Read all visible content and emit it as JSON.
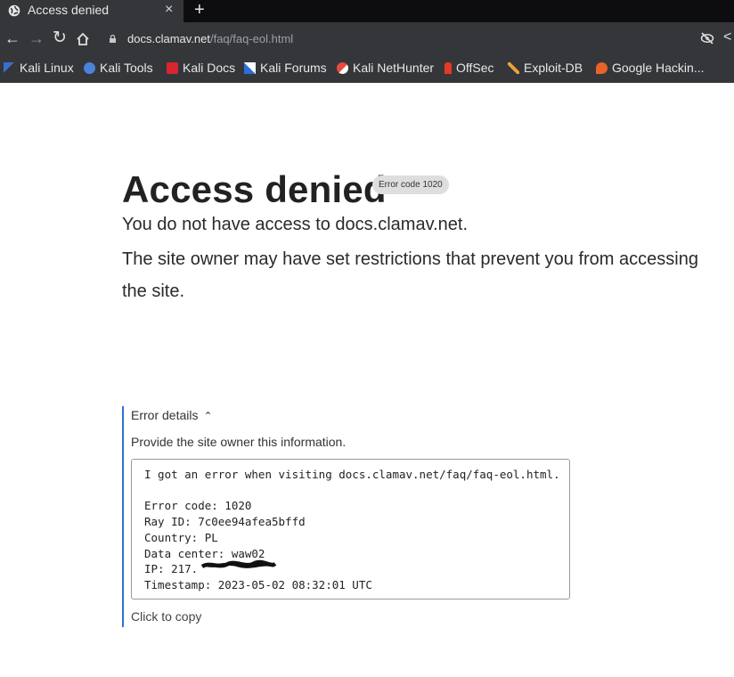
{
  "tab": {
    "title": "Access denied",
    "close": "×",
    "new_tab": "+"
  },
  "toolbar": {
    "url_host": "docs.clamav.net",
    "url_path": "/faq/faq-eol.html"
  },
  "bookmarks": [
    {
      "label": "Kali Linux",
      "icon": "kali-dragon-icon",
      "color": "#3a6fd1"
    },
    {
      "label": "Kali Tools",
      "icon": "kali-tools-icon",
      "color": "#4b83d9"
    },
    {
      "label": "Kali Docs",
      "icon": "kali-docs-icon",
      "color": "#d8262e"
    },
    {
      "label": "Kali Forums",
      "icon": "kali-forums-icon",
      "color": "#2d6fd6"
    },
    {
      "label": "Kali NetHunter",
      "icon": "nethunter-icon",
      "color": "#e84b3c"
    },
    {
      "label": "OffSec",
      "icon": "offsec-icon",
      "color": "#e23b2a"
    },
    {
      "label": "Exploit-DB",
      "icon": "exploit-db-icon",
      "color": "#e8a23a"
    },
    {
      "label": "Google Hackin...",
      "icon": "ghdb-icon",
      "color": "#e8632a"
    }
  ],
  "main": {
    "heading": "Access denied",
    "error_badge": "Error code 1020",
    "line1": "You do not have access to docs.clamav.net.",
    "line2": "The site owner may have set restrictions that prevent you from accessing",
    "line3": "the site."
  },
  "details": {
    "summary": "Error details",
    "hint": "Provide the site owner this information.",
    "lines": [
      "I got an error when visiting docs.clamav.net/faq/faq-eol.html.",
      "",
      "Error code: 1020",
      "Ray ID: 7c0ee94afea5bffd",
      "Country: PL",
      "Data center: waw02",
      "IP: 217.",
      "Timestamp: 2023-05-02 08:32:01 UTC"
    ],
    "copy_label": "Click to copy"
  },
  "colors": {
    "accent": "#2f6fd0",
    "chrome_bg": "#35363a",
    "tabstrip_bg": "#0d0d10"
  }
}
